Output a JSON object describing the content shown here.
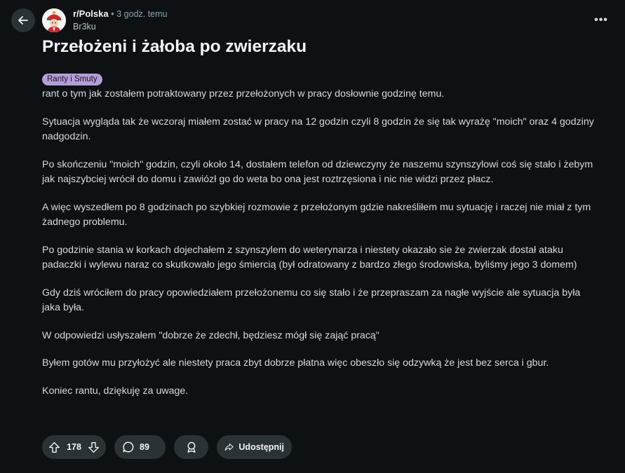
{
  "header": {
    "subreddit": "r/Polska",
    "separator": "•",
    "time_ago": "3 godz. temu",
    "author": "Br3ku",
    "more_label": "•••"
  },
  "post": {
    "title": "Przełożeni i żałoba po zwierzaku",
    "flair": "Ranty i Smuty",
    "flair_color": "#b39ddb",
    "paragraphs": [
      "rant o tym jak zostałem potraktowany przez przełożonych w pracy dosłownie godzinę temu.",
      "Sytuacja wygląda tak że wczoraj miałem zostać w pracy na 12 godzin czyli 8 godzin że się tak wyrażę \"moich\" oraz 4 godziny nadgodzin.",
      "Po skończeniu \"moich\" godzin, czyli około 14, dostałem telefon od dziewczyny że naszemu szynszylowi coś się stało i żebym jak najszybciej wrócił do domu i zawiózł go do weta bo ona jest roztrzęsiona i nic nie widzi przez płacz.",
      "A więc wyszedłem po 8 godzinach po szybkiej rozmowie z przełożonym gdzie nakreśliłem mu sytuację i raczej nie miał z tym żadnego problemu.",
      "Po godzinie stania w korkach dojechałem z szynszylem do weterynarza i niestety okazało sie że zwierzak dostał ataku padaczki i wylewu naraz co skutkowało jego śmiercią (był odratowany z bardzo złego środowiska, byliśmy jego 3 domem)",
      "Gdy dziś wróciłem do pracy opowiedziałem przełożonemu co się stało i że przepraszam za nagłe wyjście ale sytuacja była jaka była.",
      "W odpowiedzi usłyszałem \"dobrze że zdechł, będziesz mógł się zająć pracą\"",
      "Byłem gotów mu przyłożyć ale niestety praca zbyt dobrze płatna więc obeszło się odzywką że jest bez serca i gbur.",
      "Koniec rantu, dziękuję za uwage."
    ]
  },
  "actions": {
    "score": "178",
    "comments": "89",
    "share_label": "Udostępnij"
  },
  "icons": {
    "back": "arrow-left-icon",
    "upvote": "arrow-up-icon",
    "downvote": "arrow-down-icon",
    "comment": "speech-bubble-icon",
    "award": "award-icon",
    "share": "share-arrow-icon"
  },
  "colors": {
    "background": "#0e1113",
    "button_bg": "#2a3236"
  }
}
